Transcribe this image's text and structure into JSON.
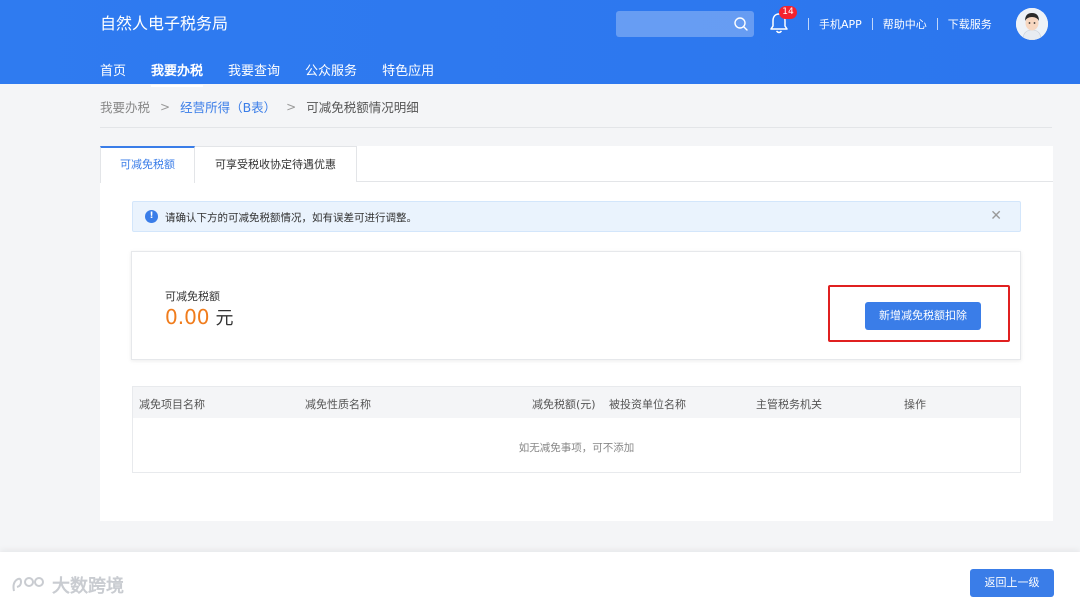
{
  "header": {
    "brand": "自然人电子税务局",
    "search": {
      "placeholder": "",
      "icon": "search-icon"
    },
    "notifications": {
      "icon": "bell-icon",
      "count": "14"
    },
    "links": [
      "手机APP",
      "帮助中心",
      "下载服务"
    ],
    "avatar_icon": "user-avatar"
  },
  "nav": {
    "items": [
      "首页",
      "我要办税",
      "我要查询",
      "公众服务",
      "特色应用"
    ],
    "active_index": 1
  },
  "breadcrumb": {
    "items": [
      "我要办税",
      "经营所得（B表）",
      "可减免税额情况明细"
    ]
  },
  "tabs": {
    "items": [
      "可减免税额",
      "可享受税收协定待遇优惠"
    ],
    "active_index": 0
  },
  "alert": {
    "icon": "info-icon",
    "text": "请确认下方的可减免税额情况，如有误差可进行调整。",
    "close_icon": "close-icon"
  },
  "amount": {
    "label": "可减免税额",
    "value": "0.00",
    "unit": "元",
    "add_button": "新增减免税额扣除"
  },
  "table": {
    "columns": [
      "减免项目名称",
      "减免性质名称",
      "减免税额(元)",
      "被投资单位名称",
      "主管税务机关",
      "操作"
    ],
    "empty_text": "如无减免事项，可不添加"
  },
  "footer": {
    "back_button": "返回上一级",
    "watermark": "大数跨境"
  },
  "colors": {
    "primary": "#3a7de8",
    "header": "#2f7bf0",
    "amount": "#f07c1c",
    "highlight": "#e02020"
  }
}
